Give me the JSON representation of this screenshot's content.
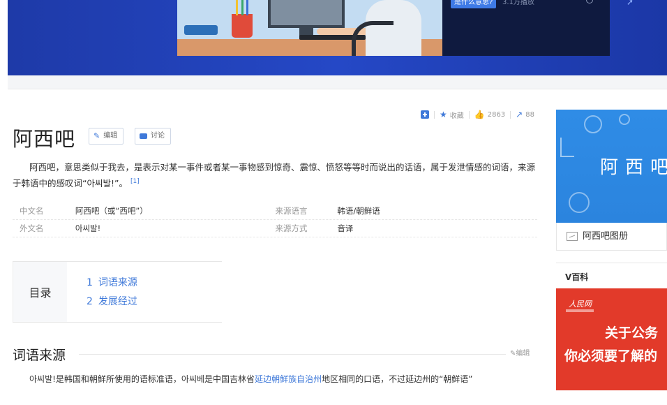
{
  "banner": {
    "badge": "是什么意思?",
    "plays": "3.1万播放"
  },
  "actions": {
    "favorite": "收藏",
    "likes": "2863",
    "shares": "88"
  },
  "title": "阿西吧",
  "title_buttons": {
    "edit": "编辑",
    "discuss": "讨论"
  },
  "summary": {
    "text": "阿西吧，意思类似于我去，是表示对某一事件或者某一事物感到惊奇、震惊、愤怒等等时而说出的话语，属于发泄情感的词语，来源于韩语中的感叹词“아씨발!”。",
    "ref": "[1]"
  },
  "info": [
    {
      "k1": "中文名",
      "v1": "阿西吧（或“西吧”）",
      "k2": "来源语言",
      "v2": "韩语/朝鲜语"
    },
    {
      "k1": "外文名",
      "v1": "아씨발!",
      "k2": "来源方式",
      "v2": "音译"
    }
  ],
  "toc": {
    "label": "目录",
    "items": [
      {
        "num": "1",
        "text": "词语来源"
      },
      {
        "num": "2",
        "text": "发展经过"
      }
    ]
  },
  "section": {
    "title": "词语来源",
    "edit": "编辑",
    "text_a": "아씨발!是韩国和朝鲜所使用的语标准语，아씨베是中国吉林省",
    "link": "延边朝鲜族自治州",
    "text_b": "地区相同的口语，不过延边州的“朝鲜语”"
  },
  "sidebar": {
    "album_word": "阿西吧",
    "album_caption": "阿西吧图册",
    "vbaike_label": "V百科",
    "ad_logo": "人民网",
    "ad_line1": "关于公务",
    "ad_line2": "你必须要了解的"
  },
  "colors": {
    "accent": "#3f79d9",
    "banner": "#2548c6",
    "ad": "#e23a2a"
  }
}
